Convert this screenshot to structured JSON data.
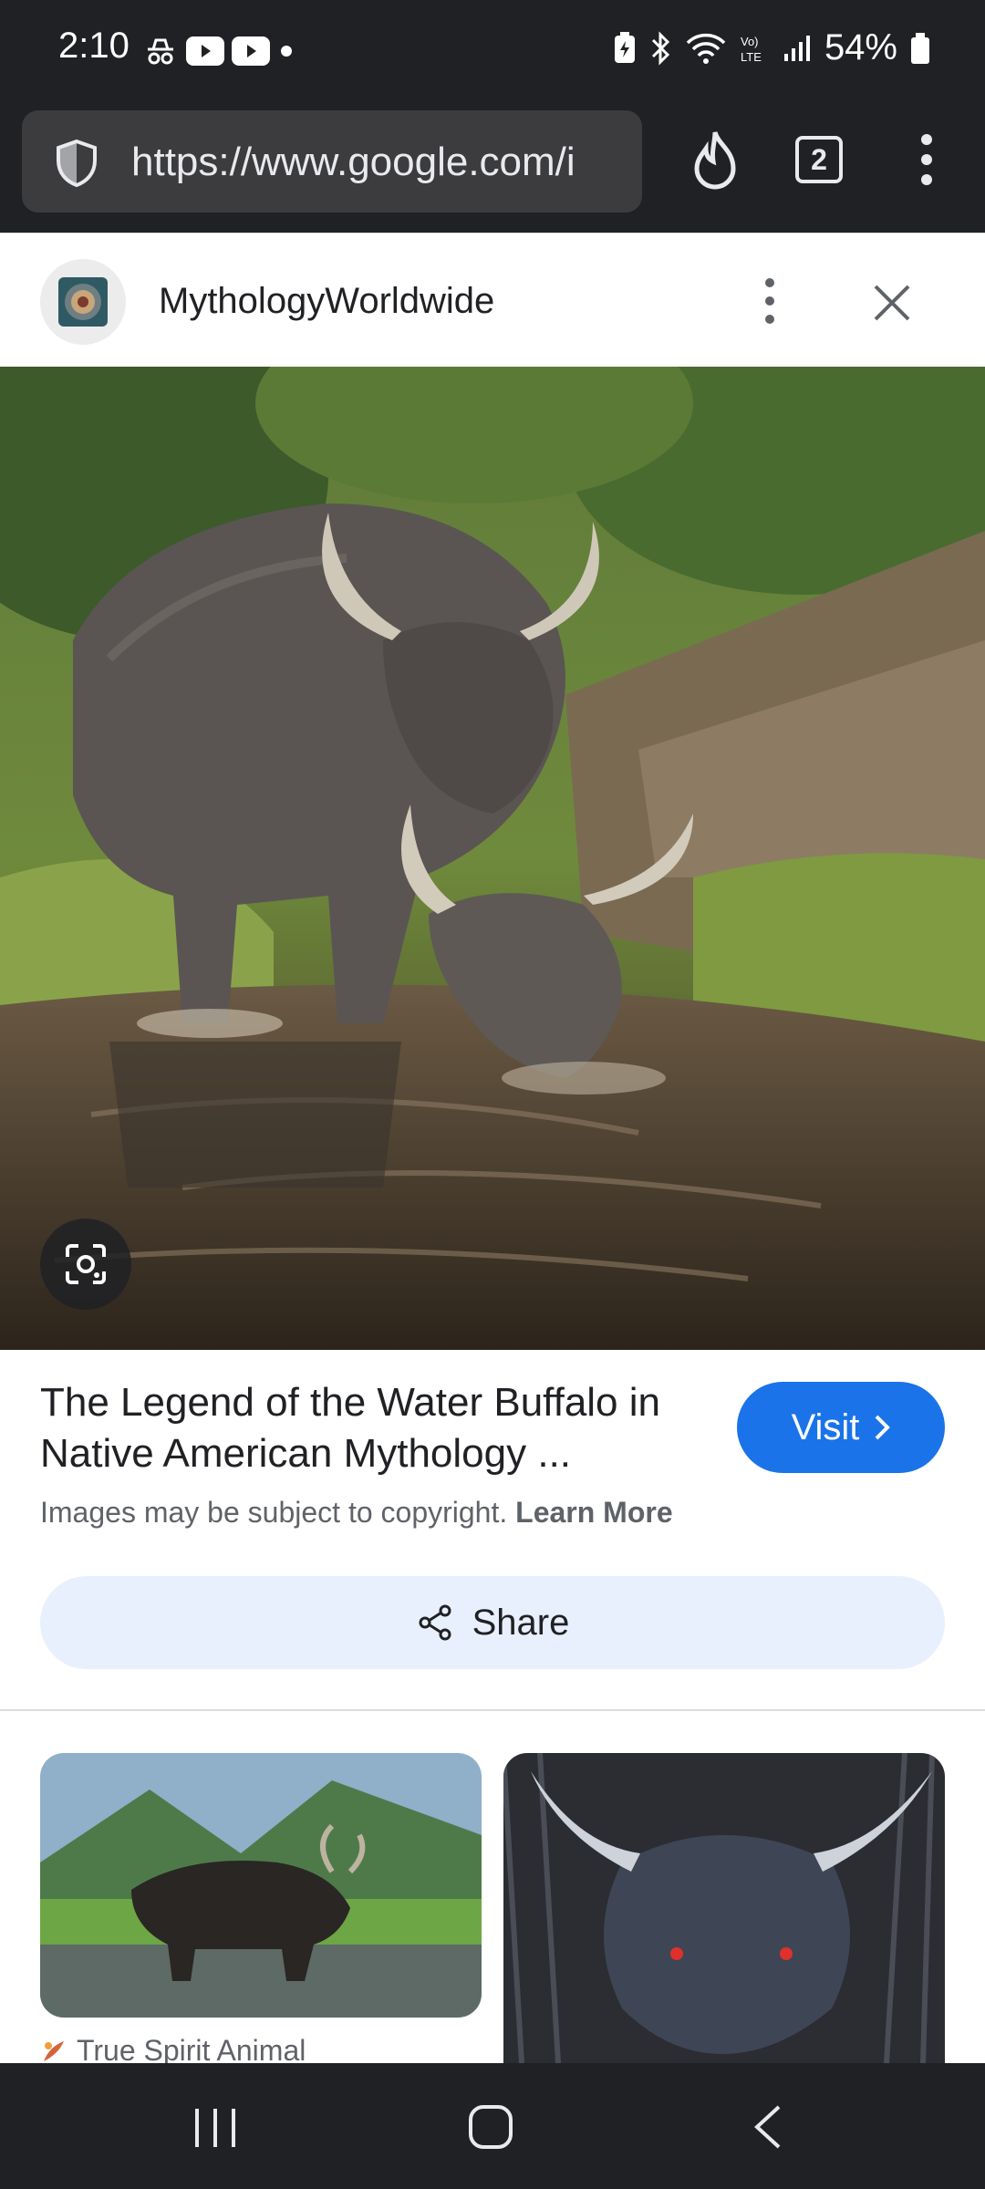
{
  "status_bar": {
    "time": "2:10",
    "battery": "54%"
  },
  "browser": {
    "url": "https://www.google.com/i",
    "tab_count": "2"
  },
  "source": {
    "name": "MythologyWorldwide"
  },
  "result": {
    "title": "The Legend of the Water Buffalo in Native American Mythology ...",
    "copyright_text": "Images may be subject to copyright.",
    "learn_more": "Learn More",
    "visit_label": "Visit",
    "share_label": "Share"
  },
  "related": {
    "caption_1": "True Spirit Animal"
  },
  "colors": {
    "accent": "#1a73e8",
    "share_bg": "#e8f0fe",
    "chrome_dark": "#202124"
  }
}
